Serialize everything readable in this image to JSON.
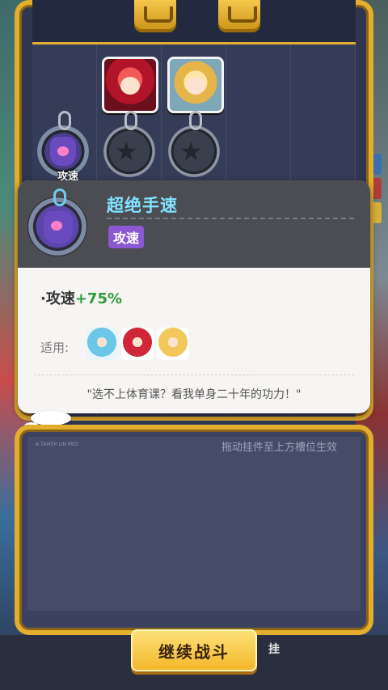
{
  "pendant_area": {
    "heroes": [
      {
        "name": "red-hair-hero",
        "color": "#c41e3a"
      },
      {
        "name": "yellow-hat-hero",
        "color": "#f2c85d"
      }
    ],
    "equipped_label": "攻速"
  },
  "tooltip": {
    "title": "超绝手速",
    "tag": "攻速",
    "stat_prefix": "·攻速",
    "stat_value": "+75%",
    "applies_label": "适用:",
    "quote": "\"选不上体育课？看我单身二十年的功力！\""
  },
  "inventory": {
    "hint": "拖动挂件至上方槽位生效",
    "tiny_text": "A TAMER LIN MED"
  },
  "footer": {
    "continue_label": "继续战斗",
    "auto_label": "挂"
  },
  "colors": {
    "gold": "#e3ad2e",
    "title_cyan": "#7fe3ff",
    "tag_purple": "#8c57d3",
    "stat_green": "#2f9b3f"
  }
}
